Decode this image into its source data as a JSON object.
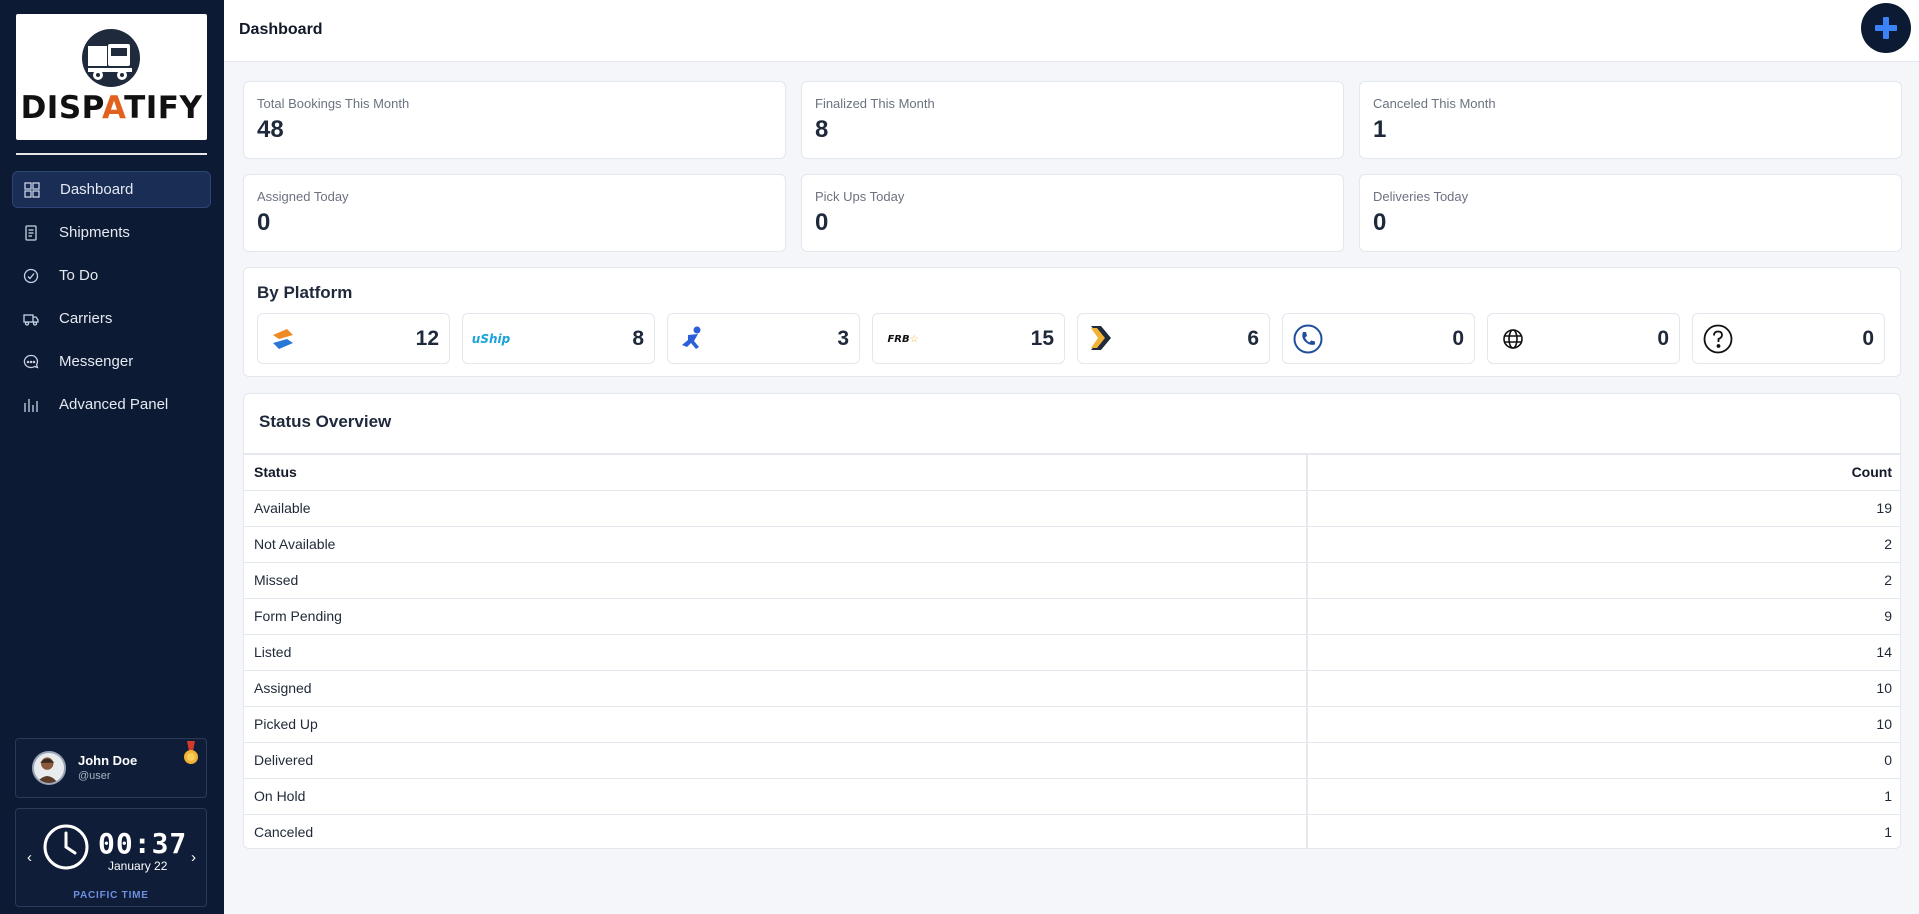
{
  "brand": {
    "logo_text_a": "DISP",
    "logo_text_accent": "A",
    "logo_text_b": "TIFY"
  },
  "sidebar": {
    "items": [
      {
        "label": "Dashboard",
        "icon": "grid-icon",
        "active": true
      },
      {
        "label": "Shipments",
        "icon": "document-icon"
      },
      {
        "label": "To Do",
        "icon": "check-circle-icon"
      },
      {
        "label": "Carriers",
        "icon": "truck-icon"
      },
      {
        "label": "Messenger",
        "icon": "chat-icon"
      },
      {
        "label": "Advanced Panel",
        "icon": "bar-chart-icon"
      }
    ]
  },
  "user": {
    "name": "John Doe",
    "handle": "@user"
  },
  "clock": {
    "time": "00:37",
    "date": "January 22",
    "timezone": "PACIFIC TIME",
    "prev": "‹",
    "next": "›"
  },
  "header": {
    "title": "Dashboard"
  },
  "stats": [
    {
      "label": "Total Bookings This Month",
      "value": "48"
    },
    {
      "label": "Finalized This Month",
      "value": "8"
    },
    {
      "label": "Canceled This Month",
      "value": "1"
    },
    {
      "label": "Assigned Today",
      "value": "0"
    },
    {
      "label": "Pick Ups Today",
      "value": "0"
    },
    {
      "label": "Deliveries Today",
      "value": "0"
    }
  ],
  "platform": {
    "title": "By Platform",
    "items": [
      {
        "icon": "exchange-logo-icon",
        "count": "12"
      },
      {
        "icon": "uship-logo-icon",
        "text": "uShip",
        "count": "8"
      },
      {
        "icon": "runner-logo-icon",
        "count": "3"
      },
      {
        "icon": "frb-logo-icon",
        "text": "FRB",
        "count": "15"
      },
      {
        "icon": "chevrons-logo-icon",
        "count": "6"
      },
      {
        "icon": "phone-icon",
        "count": "0"
      },
      {
        "icon": "globe-icon",
        "count": "0"
      },
      {
        "icon": "question-icon",
        "count": "0"
      }
    ]
  },
  "status_overview": {
    "title": "Status Overview",
    "columns": [
      "Status",
      "Count"
    ],
    "rows": [
      [
        "Available",
        "19"
      ],
      [
        "Not Available",
        "2"
      ],
      [
        "Missed",
        "2"
      ],
      [
        "Form Pending",
        "9"
      ],
      [
        "Listed",
        "14"
      ],
      [
        "Assigned",
        "10"
      ],
      [
        "Picked Up",
        "10"
      ],
      [
        "Delivered",
        "0"
      ],
      [
        "On Hold",
        "1"
      ],
      [
        "Canceled",
        "1"
      ]
    ]
  },
  "colors": {
    "sidebar_bg": "#0d1a33",
    "accent": "#e0621e",
    "add_button_icon": "#3b82f6"
  }
}
